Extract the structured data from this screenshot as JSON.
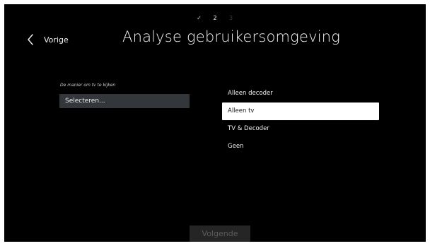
{
  "steps": [
    {
      "label": "✓",
      "state": "done"
    },
    {
      "label": "2",
      "state": "current"
    },
    {
      "label": "3",
      "state": "future"
    }
  ],
  "header": {
    "back_label": "Vorige",
    "back_icon": "chevron-left-icon",
    "title": "Analyse gebruikersomgeving"
  },
  "form": {
    "field_label": "De manier om tv te kijken",
    "select_value": "Selecteren..."
  },
  "options": [
    {
      "label": "Alleen decoder",
      "selected": false
    },
    {
      "label": "Alleen tv",
      "selected": true
    },
    {
      "label": "TV & Decoder",
      "selected": false
    },
    {
      "label": "Geen",
      "selected": false
    }
  ],
  "footer": {
    "next_label": "Volgende"
  },
  "colors": {
    "background": "#000000",
    "field_background": "#33373c",
    "selected_option": "#ffffff",
    "disabled_button": "#252525"
  }
}
